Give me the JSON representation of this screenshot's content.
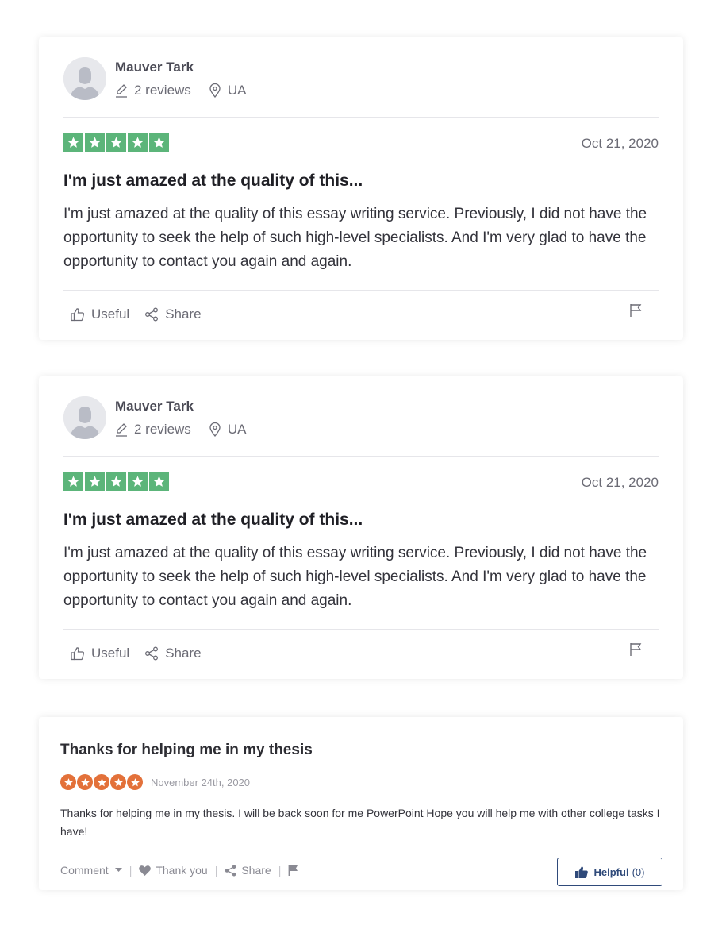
{
  "reviews_tp": [
    {
      "reviewer": "Mauver Tark",
      "review_count": "2 reviews",
      "location": "UA",
      "stars": 5,
      "date": "Oct 21, 2020",
      "title": "I'm just amazed at the quality of this...",
      "body": "I'm just amazed at the quality of this essay writing service. Previously, I did not have the opportunity to seek the help of such high-level specialists. And I'm very glad to have the opportunity to contact you again and again.",
      "useful_label": "Useful",
      "share_label": "Share"
    },
    {
      "reviewer": "Mauver Tark",
      "review_count": "2 reviews",
      "location": "UA",
      "stars": 5,
      "date": "Oct 21, 2020",
      "title": "I'm just amazed at the quality of this...",
      "body": "I'm just amazed at the quality of this essay writing service. Previously, I did not have the opportunity to seek the help of such high-level specialists. And I'm very glad to have the opportunity to contact you again and again.",
      "useful_label": "Useful",
      "share_label": "Share"
    }
  ],
  "review_alt": {
    "title": "Thanks for helping me in my thesis",
    "stars": 5,
    "date": "November 24th, 2020",
    "body": "Thanks for helping me in my thesis. I will be back soon for me PowerPoint Hope you will help me with other college tasks I have!",
    "comment_label": "Comment",
    "thank_label": "Thank you",
    "share_label": "Share",
    "helpful_label": "Helpful",
    "helpful_count": "(0)"
  },
  "colors": {
    "trustpilot_green": "#5cb57a",
    "rating_orange": "#e3713a",
    "helpful_navy": "#2f4a7a"
  },
  "icons": [
    "user-avatar-icon",
    "pencil-icon",
    "location-pin-icon",
    "star-icon",
    "thumbs-up-icon",
    "share-icon",
    "flag-icon",
    "caret-down-icon",
    "heart-icon"
  ]
}
